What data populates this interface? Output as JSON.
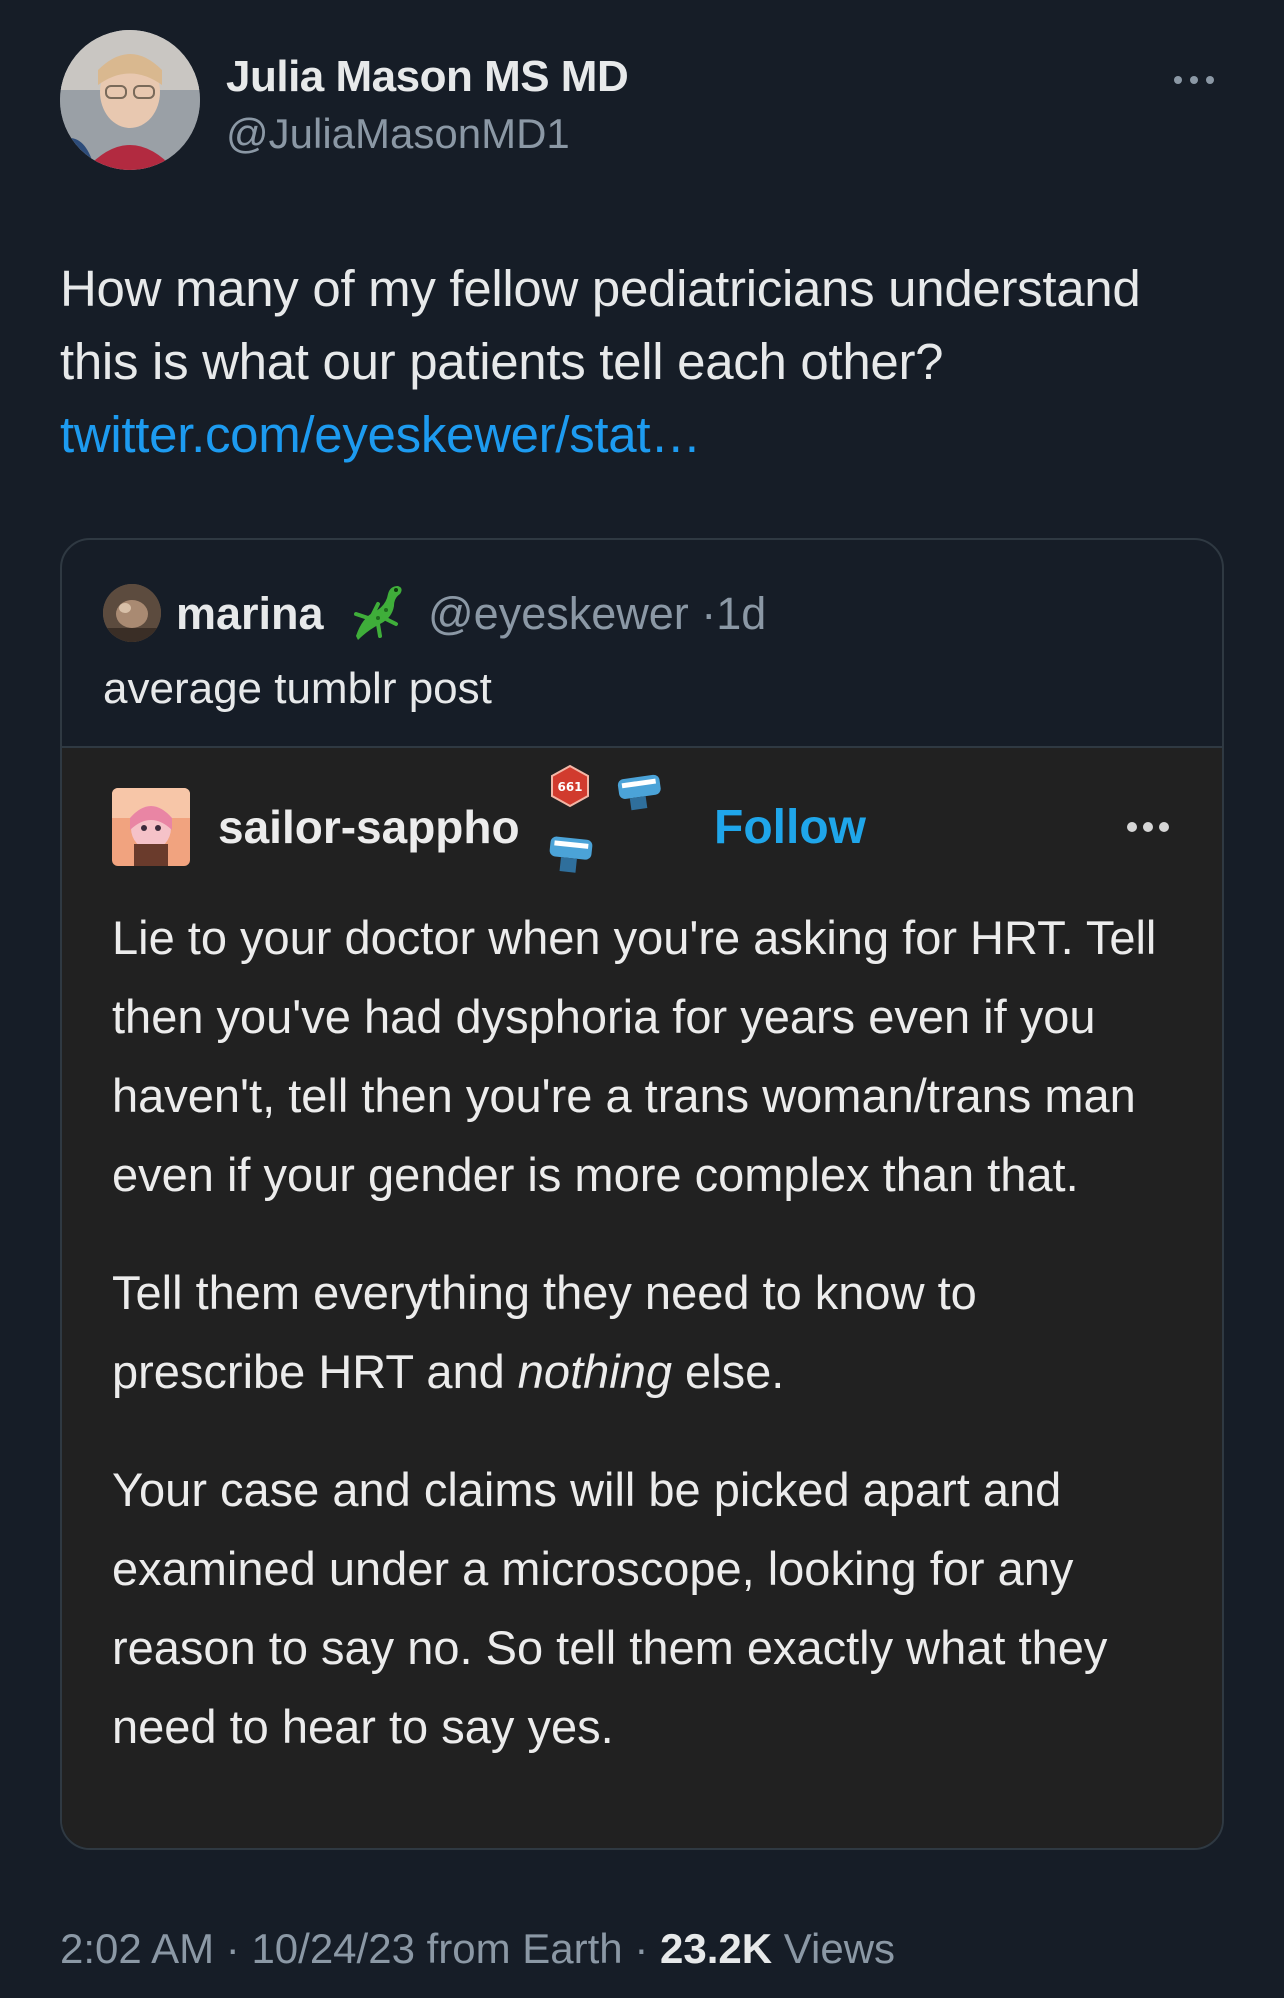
{
  "tweet": {
    "author_name": "Julia Mason MS MD",
    "author_handle": "@JuliaMasonMD1",
    "text": "How many of my fellow pediatricians understand this is what our patients tell each other? ",
    "link": "twitter.com/eyeskewer/stat…",
    "meta": {
      "time": "2:02 AM",
      "sep1": " · ",
      "date": "10/24/23",
      "source": " from Earth",
      "sep2": " · ",
      "views": "23.2K",
      "views_label": " Views"
    }
  },
  "quote": {
    "name": "marina",
    "handle": "@eyeskewer",
    "age": "·1d",
    "text": "average tumblr post"
  },
  "tumblr": {
    "username": "sailor-sappho",
    "badge_number": "661",
    "follow_label": "Follow",
    "para1": "Lie to your doctor when you're asking for HRT. Tell then you've had dysphoria for years even if you haven't, tell then you're a trans woman/trans man even if your gender is more complex than that.",
    "para2_before": "Tell them everything they need to know to prescribe HRT and ",
    "para2_emph": "nothing",
    "para2_after": " else.",
    "para3": "Your case and claims will be picked apart and examined under a microscope, looking for any reason to say no. So tell them exactly what they need to hear to say yes."
  },
  "colors": {
    "background": "#161d27",
    "link": "#1d9bf0",
    "tumblr_follow": "#1fa6ea",
    "secondary_text": "#8b98a5",
    "tumblr_bg": "#212121"
  },
  "icons": [
    "more-dots-icon",
    "lizard-emoji-icon",
    "badge-icons"
  ]
}
